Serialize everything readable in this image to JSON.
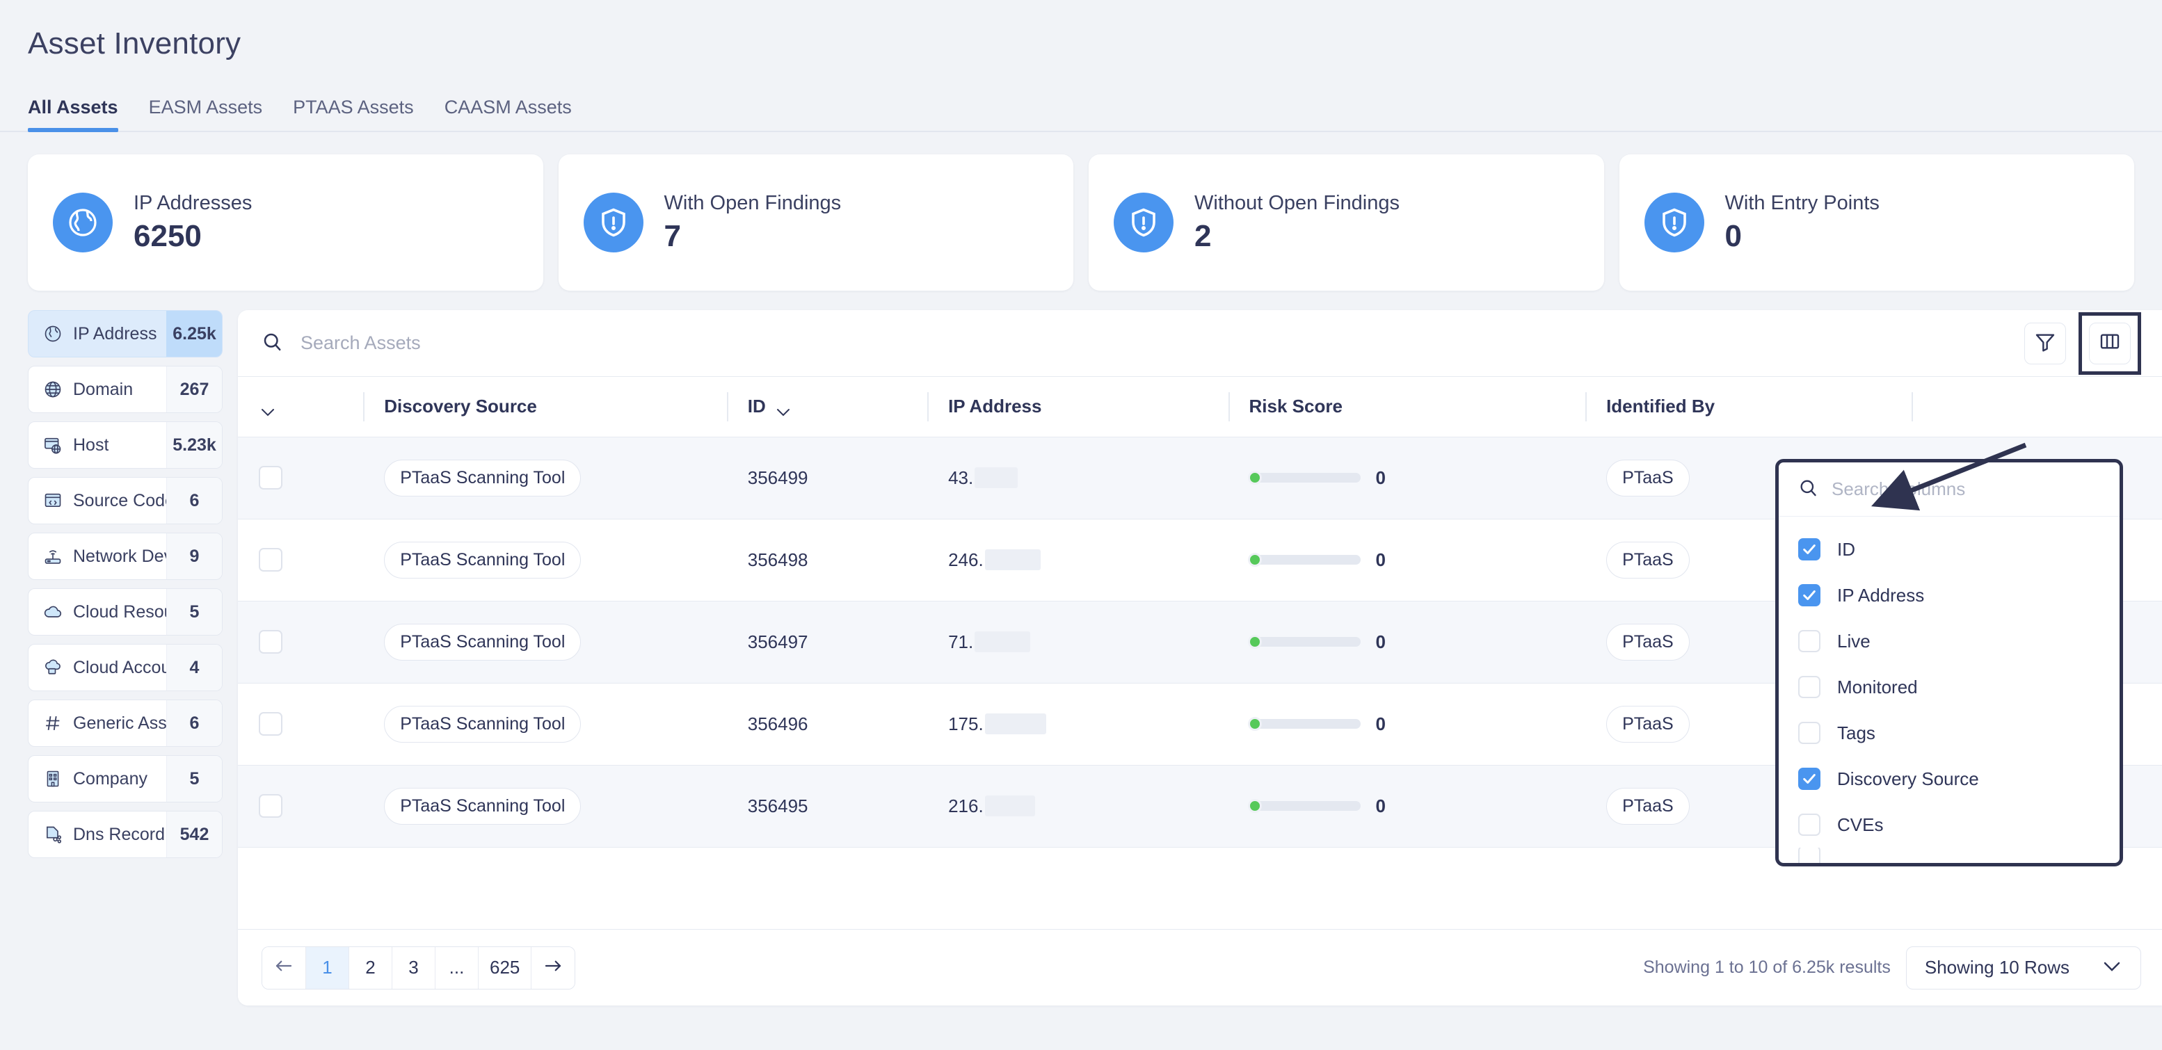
{
  "header": {
    "title": "Asset Inventory"
  },
  "tabs": [
    {
      "label": "All Assets",
      "active": true
    },
    {
      "label": "EASM Assets",
      "active": false
    },
    {
      "label": "PTAAS Assets",
      "active": false
    },
    {
      "label": "CAASM Assets",
      "active": false
    }
  ],
  "stats": [
    {
      "label": "IP Addresses",
      "value": "6250",
      "icon": "globe-icon"
    },
    {
      "label": "With Open Findings",
      "value": "7",
      "icon": "shield-alert-icon"
    },
    {
      "label": "Without Open Findings",
      "value": "2",
      "icon": "shield-alert-icon"
    },
    {
      "label": "With Entry Points",
      "value": "0",
      "icon": "shield-alert-icon"
    }
  ],
  "sidebar": [
    {
      "label": "IP Address",
      "count": "6.25k",
      "icon": "globe-asset-icon",
      "active": true
    },
    {
      "label": "Domain",
      "count": "267",
      "icon": "domain-globe-icon",
      "active": false
    },
    {
      "label": "Host",
      "count": "5.23k",
      "icon": "host-window-icon",
      "active": false
    },
    {
      "label": "Source Code",
      "count": "6",
      "icon": "source-code-icon",
      "active": false
    },
    {
      "label": "Network Device",
      "count": "9",
      "icon": "router-icon",
      "active": false
    },
    {
      "label": "Cloud Resource",
      "count": "5",
      "icon": "cloud-icon",
      "active": false
    },
    {
      "label": "Cloud Account",
      "count": "4",
      "icon": "cloud-account-icon",
      "active": false
    },
    {
      "label": "Generic Asset",
      "count": "6",
      "icon": "hash-icon",
      "active": false
    },
    {
      "label": "Company",
      "count": "5",
      "icon": "building-icon",
      "active": false
    },
    {
      "label": "Dns Record",
      "count": "542",
      "icon": "dns-record-icon",
      "active": false
    }
  ],
  "toolbar": {
    "search_placeholder": "Search Assets",
    "search_value": "",
    "filter_icon": "filter-icon",
    "columns_icon": "columns-icon"
  },
  "table": {
    "columns": [
      {
        "key": "check",
        "label": ""
      },
      {
        "key": "src",
        "label": "Discovery Source"
      },
      {
        "key": "id",
        "label": "ID"
      },
      {
        "key": "ip",
        "label": "IP Address"
      },
      {
        "key": "risk",
        "label": "Risk Score"
      },
      {
        "key": "idby",
        "label": "Identified By"
      }
    ],
    "rows": [
      {
        "source": "PTaaS Scanning Tool",
        "id": "356499",
        "ip_prefix": "43.",
        "redact_width": 62,
        "risk": "0",
        "identified_by": "PTaaS"
      },
      {
        "source": "PTaaS Scanning Tool",
        "id": "356498",
        "ip_prefix": "246.",
        "redact_width": 80,
        "risk": "0",
        "identified_by": "PTaaS"
      },
      {
        "source": "PTaaS Scanning Tool",
        "id": "356497",
        "ip_prefix": "71.",
        "redact_width": 80,
        "risk": "0",
        "identified_by": "PTaaS"
      },
      {
        "source": "PTaaS Scanning Tool",
        "id": "356496",
        "ip_prefix": "175.",
        "redact_width": 88,
        "risk": "0",
        "identified_by": "PTaaS"
      },
      {
        "source": "PTaaS Scanning Tool",
        "id": "356495",
        "ip_prefix": "216.",
        "redact_width": 72,
        "risk": "0",
        "identified_by": "PTaaS"
      }
    ]
  },
  "pagination": {
    "prev_icon": "arrow-left-icon",
    "next_icon": "arrow-right-icon",
    "pages": [
      "1",
      "2",
      "3",
      "...",
      "625"
    ],
    "current_page": "1",
    "results_text": "Showing 1 to 10 of 6.25k results",
    "rows_select_label": "Showing 10 Rows"
  },
  "columns_dropdown": {
    "search_placeholder": "Search Columns",
    "search_value": "",
    "items": [
      {
        "label": "ID",
        "checked": true
      },
      {
        "label": "IP Address",
        "checked": true
      },
      {
        "label": "Live",
        "checked": false
      },
      {
        "label": "Monitored",
        "checked": false
      },
      {
        "label": "Tags",
        "checked": false
      },
      {
        "label": "Discovery Source",
        "checked": true
      },
      {
        "label": "CVEs",
        "checked": false
      }
    ]
  },
  "colors": {
    "accent": "#4a95ef",
    "risk_dot": "#56c95a",
    "page_bg": "#f1f3f7",
    "annotation": "#2f3350"
  }
}
